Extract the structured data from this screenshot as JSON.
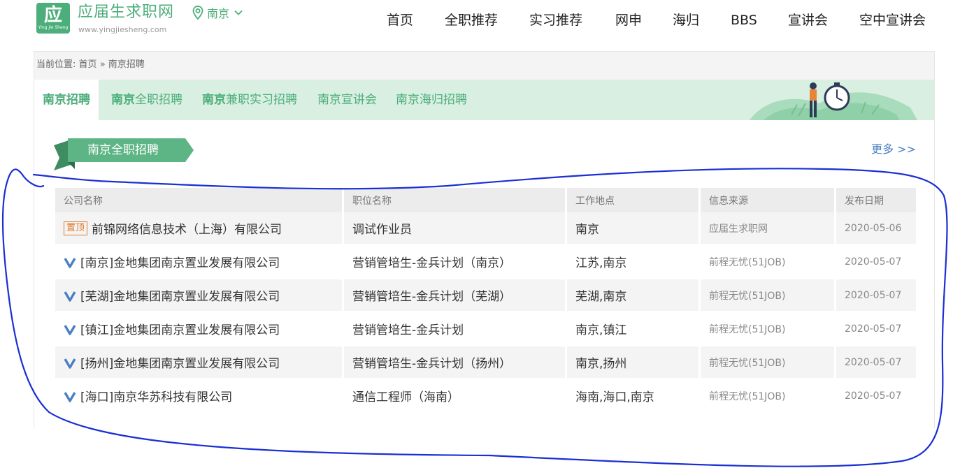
{
  "header": {
    "logo": {
      "glyph": "应",
      "sub": "Ying Jie Sheng"
    },
    "brand_name": "应届生求职网",
    "brand_url": "www.yingjiesheng.com",
    "city": "南京",
    "nav": [
      "首页",
      "全职推荐",
      "实习推荐",
      "网申",
      "海归",
      "BBS",
      "宣讲会",
      "空中宣讲会"
    ]
  },
  "breadcrumb": {
    "prefix": "当前位置:",
    "home": "首页",
    "sep": "»",
    "current": "南京招聘"
  },
  "tabs": [
    {
      "label": "南京招聘"
    },
    {
      "bold": "南京",
      "label": "全职招聘"
    },
    {
      "bold": "南京",
      "label": "兼职实习招聘"
    },
    {
      "label": "南京宣讲会"
    },
    {
      "label": "南京海归招聘"
    }
  ],
  "section": {
    "title": "南京全职招聘",
    "more": "更多 >>"
  },
  "table": {
    "columns": [
      "公司名称",
      "职位名称",
      "工作地点",
      "信息来源",
      "发布日期"
    ],
    "pinned_badge": "置顶",
    "rows": [
      {
        "company": "前锦网络信息技术（上海）有限公司",
        "position": "调试作业员",
        "location": "南京",
        "source": "应届生求职网",
        "date": "2020-05-06",
        "marker": "pinned"
      },
      {
        "company": "[南京]金地集团南京置业发展有限公司",
        "position": "营销管培生-金兵计划（南京）",
        "location": "江苏,南京",
        "source": "前程无忧(51JOB)",
        "date": "2020-05-07",
        "marker": "v"
      },
      {
        "company": "[芜湖]金地集团南京置业发展有限公司",
        "position": "营销管培生-金兵计划（芜湖）",
        "location": "芜湖,南京",
        "source": "前程无忧(51JOB)",
        "date": "2020-05-07",
        "marker": "v"
      },
      {
        "company": "[镇江]金地集团南京置业发展有限公司",
        "position": "营销管培生-金兵计划",
        "location": "南京,镇江",
        "source": "前程无忧(51JOB)",
        "date": "2020-05-07",
        "marker": "v"
      },
      {
        "company": "[扬州]金地集团南京置业发展有限公司",
        "position": "营销管培生-金兵计划（扬州）",
        "location": "南京,扬州",
        "source": "前程无忧(51JOB)",
        "date": "2020-05-07",
        "marker": "v"
      },
      {
        "company": "[海口]南京华苏科技有限公司",
        "position": "通信工程师（海南）",
        "location": "海南,海口,南京",
        "source": "前程无忧(51JOB)",
        "date": "2020-05-07",
        "marker": "v"
      }
    ]
  },
  "colors": {
    "brand": "#4cae7a",
    "tab_bg": "#d9efe2",
    "link": "#4a7fc4",
    "badge": "#e07a2a",
    "annotation": "#1a2fd4"
  }
}
